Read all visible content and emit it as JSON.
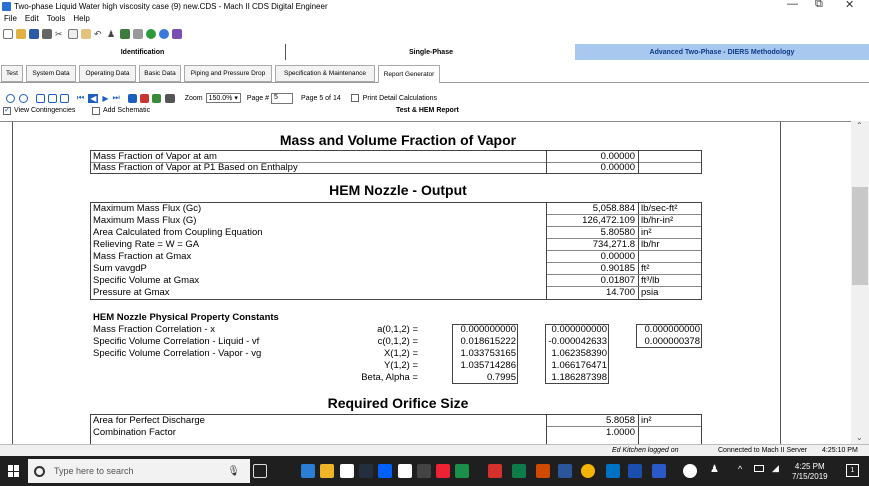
{
  "window": {
    "title": "Two-phase Liquid Water high viscosity case (9) new.CDS - Mach II CDS Digital Engineer",
    "minimize": "—",
    "restore": "⧉",
    "close": "✕"
  },
  "menu": [
    "File",
    "Edit",
    "Tools",
    "Help"
  ],
  "section_tabs": {
    "identification": "Identification",
    "single_phase": "Single-Phase",
    "advanced": "Advanced Two-Phase - DIERS Methodology"
  },
  "sub_tabs": [
    "Test",
    "System Data",
    "Operating Data",
    "Basic Data",
    "Piping and Pressure Drop",
    "Specification & Maintenance",
    "Report Generator"
  ],
  "toolbar2": {
    "zoom_label": "Zoom",
    "zoom_value": "150.0%",
    "page_label": "Page #",
    "page_value": "5",
    "page_info": "Page 5 of 14",
    "print_detail": "Print Detail Calculations"
  },
  "options": {
    "view_contingencies": "View Contingencies",
    "add_schematic": "Add Schematic",
    "report_name": "Test & HEM Report"
  },
  "report": {
    "mass_volume_title": "Mass and Volume Fraction of Vapor",
    "mass_volume_rows": [
      {
        "label": "Mass Fraction of Vapor at am",
        "value": "0.00000",
        "unit": ""
      },
      {
        "label": "Mass Fraction of Vapor at P1 Based on Enthalpy",
        "value": "0.00000",
        "unit": ""
      }
    ],
    "hem_title": "HEM Nozzle - Output",
    "hem_rows": [
      {
        "label": "Maximum Mass Flux (Gc)",
        "value": "5,058.884",
        "unit": "lb/sec-ft²"
      },
      {
        "label": "Maximum Mass Flux (G)",
        "value": "126,472.109",
        "unit": "lb/hr-in²"
      },
      {
        "label": "Area Calculated from Coupling Equation",
        "value": "5.80580",
        "unit": "in²"
      },
      {
        "label": "Relieving Rate = W = GA",
        "value": "734,271.8",
        "unit": "lb/hr"
      },
      {
        "label": "Mass Fraction at Gmax",
        "value": "0.00000",
        "unit": ""
      },
      {
        "label": "Sum vavgdP",
        "value": "0.90185",
        "unit": "ft²"
      },
      {
        "label": "Specific Volume at Gmax",
        "value": "0.01807",
        "unit": "ft³/lb"
      },
      {
        "label": "Pressure at Gmax",
        "value": "14.700",
        "unit": "psia"
      }
    ],
    "constants_title": "HEM Nozzle Physical Property Constants",
    "constants_labels": [
      "Mass Fraction Correlation - x",
      "Specific Volume Correlation - Liquid - vf",
      "Specific Volume Correlation - Vapor - vg"
    ],
    "constants_rows": [
      {
        "name": "a(0,1,2) =",
        "c0": "0.000000000",
        "c1": "0.000000000",
        "c2": "0.000000000"
      },
      {
        "name": "c(0,1,2) =",
        "c0": "0.018615222",
        "c1": "-0.000042633",
        "c2": "0.000000378"
      },
      {
        "name": "X(1,2) =",
        "c0": "1.033753165",
        "c1": "1.062358390",
        "c2": ""
      },
      {
        "name": "Y(1,2) =",
        "c0": "1.035714286",
        "c1": "1.066176471",
        "c2": ""
      },
      {
        "name": "Beta, Alpha =",
        "c0": "0.7995",
        "c1": "1.186287398",
        "c2": ""
      }
    ],
    "orifice_title": "Required Orifice Size",
    "orifice_rows": [
      {
        "label": "Area for Perfect Discharge",
        "value": "5.8058",
        "unit": "in²"
      },
      {
        "label": "Combination Factor",
        "value": "1.0000",
        "unit": ""
      }
    ]
  },
  "status": {
    "user": "Ed Kitchen logged on",
    "server": "Connected to Mach II Server",
    "time": "4:25:10 PM"
  },
  "taskbar": {
    "search_placeholder": "Type here to search",
    "clock_time": "4:25 PM",
    "clock_date": "7/15/2019"
  },
  "colors": {
    "advanced_tab_bg": "#a9c8ef",
    "accent_blue": "#1d5fbf",
    "taskbar": "#1f1f1f"
  }
}
